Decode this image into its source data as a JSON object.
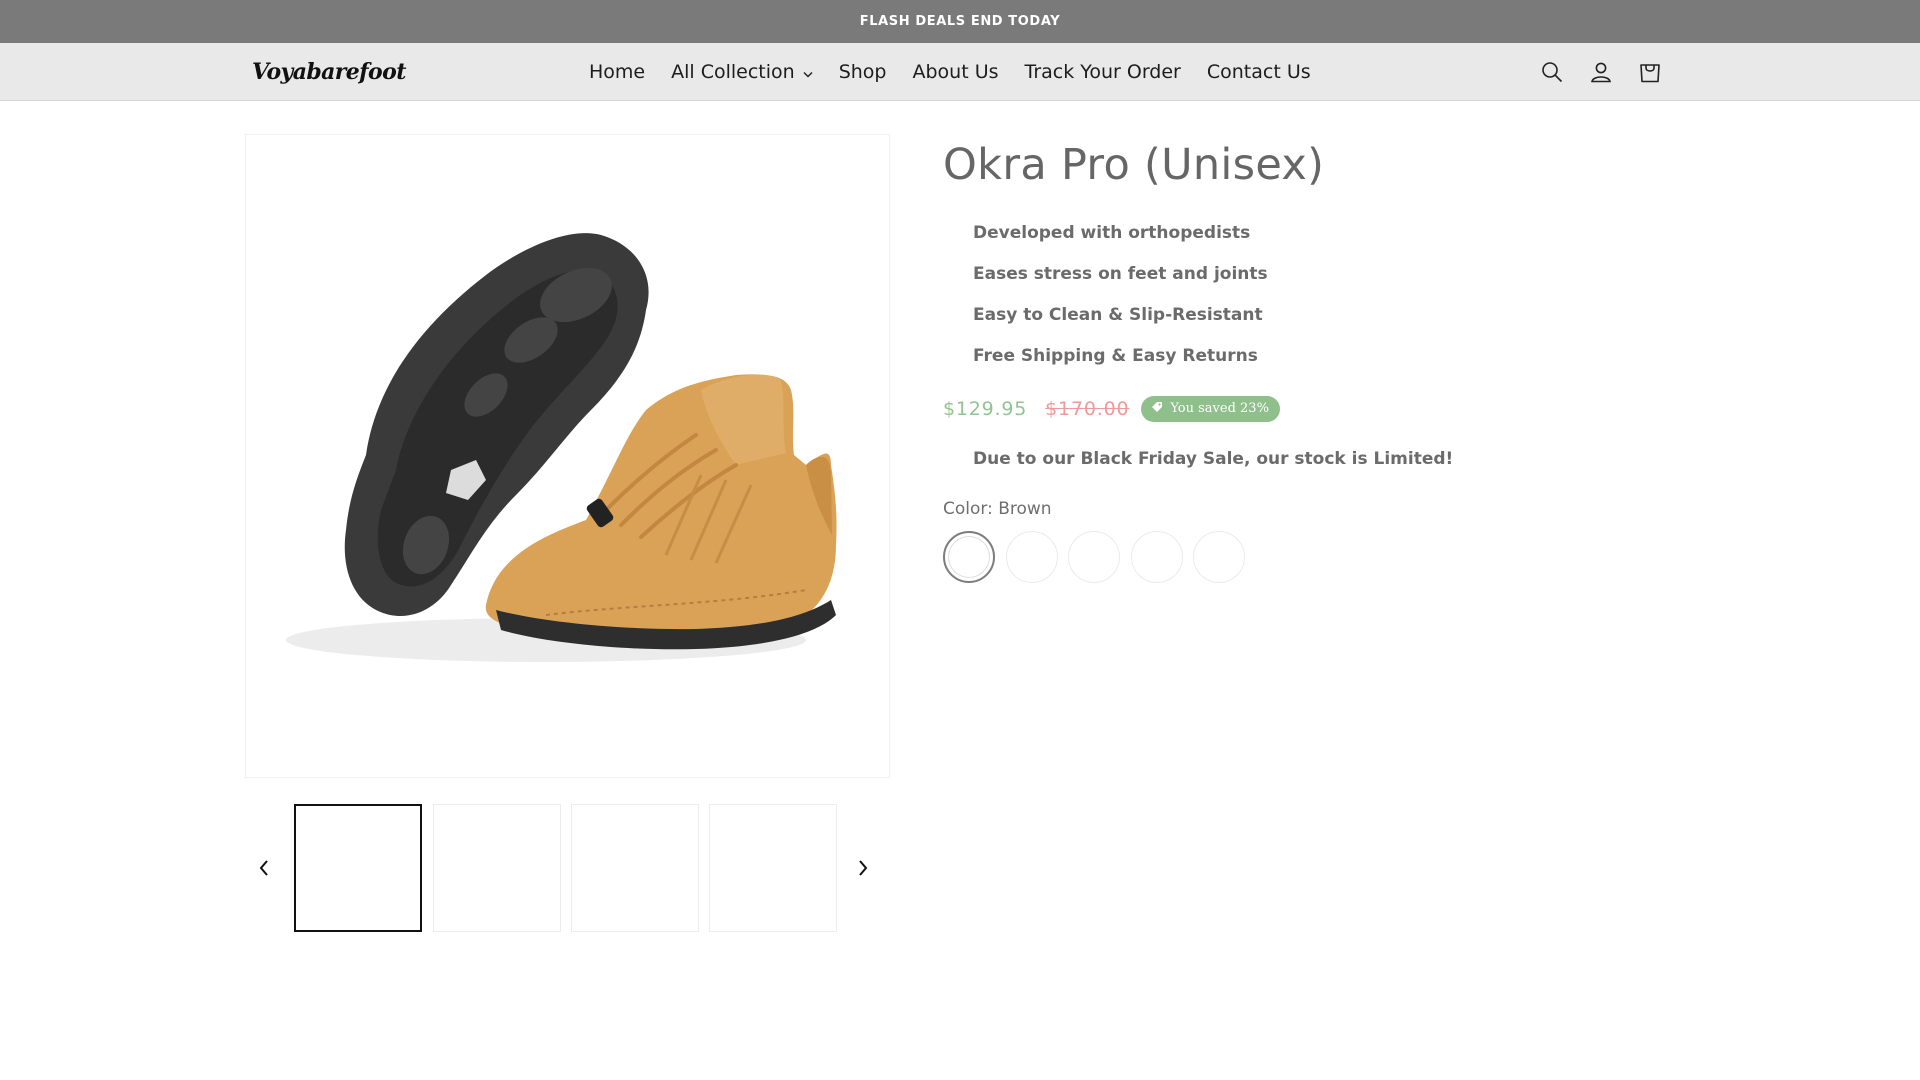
{
  "announcement": {
    "text": "FLASH DEALS END TODAY"
  },
  "header": {
    "logo_text": "Voyabarefoot",
    "nav": [
      {
        "label": "Home"
      },
      {
        "label": "All Collection"
      },
      {
        "label": "Shop"
      },
      {
        "label": "About Us"
      },
      {
        "label": "Track Your Order"
      },
      {
        "label": "Contact Us"
      }
    ],
    "icons": [
      "search-icon",
      "account-icon",
      "cart-icon"
    ]
  },
  "gallery": {
    "main_image": "shoe-image",
    "thumbnails_count_visible": 4,
    "selected_thumbnail": 1
  },
  "product": {
    "title": "Okra Pro (Unisex)",
    "features": [
      "Developed with orthopedists",
      "Eases stress on feet and joints",
      "Easy to Clean & Slip-Resistant",
      "Free Shipping & Easy Returns"
    ],
    "price": "$129.95",
    "compare_price": "$170.00",
    "badge": "You saved 23%",
    "stock_notice": "Due to our Black Friday Sale, our stock is Limited!",
    "color_label": "Color: Brown",
    "swatch_count": 5,
    "selected_swatch": 1
  },
  "colors": {
    "announcement_bg": "#7a7a7a",
    "header_bg": "#e9e9e9",
    "price_sale": "#93c391",
    "price_compare": "#ee9a9a",
    "badge_bg": "#8fbf8a"
  }
}
